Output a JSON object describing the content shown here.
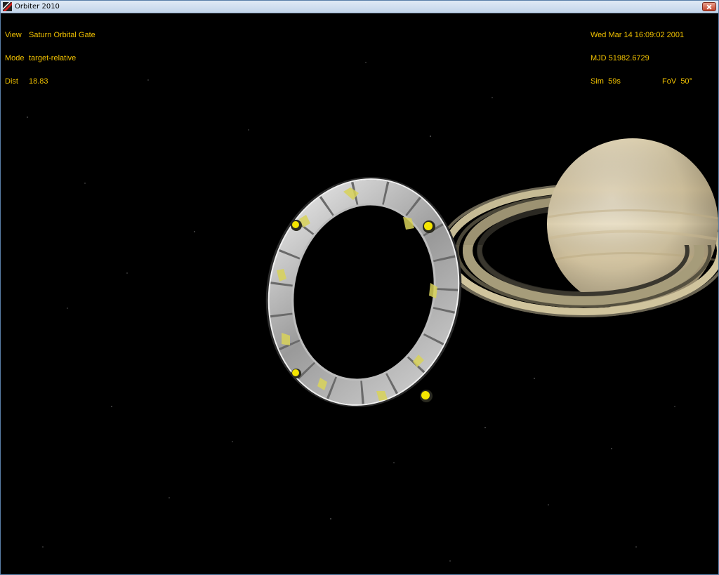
{
  "window": {
    "title": "Orbiter 2010",
    "app_icon": "orbiter-icon",
    "close_icon": "close-icon"
  },
  "hud_left": {
    "view_label": "View",
    "view_value": "Saturn Orbital Gate",
    "mode_label": "Mode",
    "mode_value": "target-relative",
    "dist_label": "Dist",
    "dist_value": "18.83"
  },
  "hud_right": {
    "datetime": "Wed Mar 14 16:09:02 2001",
    "mjd_label": "MJD",
    "mjd_value": "51982.6729",
    "sim_label": "Sim",
    "sim_value": "59s",
    "fov_label": "FoV",
    "fov_value": "50°"
  },
  "colors": {
    "hud_text": "#f2c200",
    "background": "#000000",
    "planet": "#dcd0b4",
    "gate_lights": "#f5e600"
  }
}
